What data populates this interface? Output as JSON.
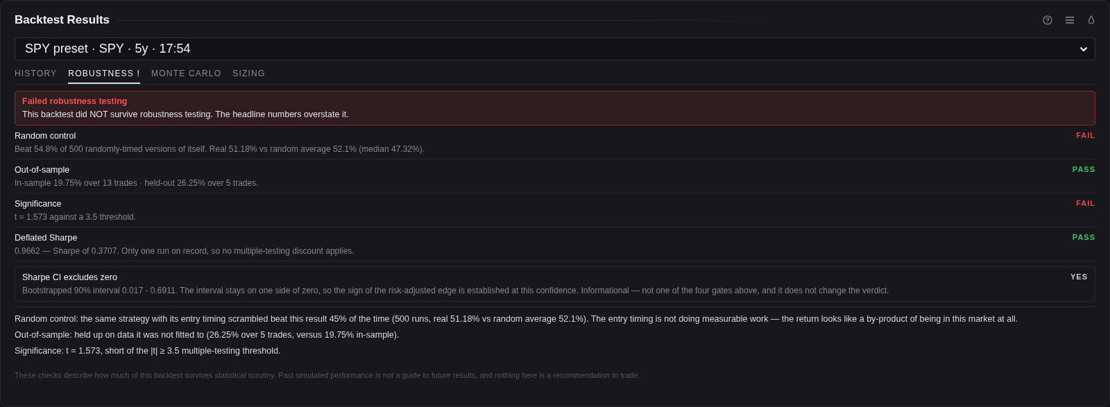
{
  "panel": {
    "title": "Backtest Results"
  },
  "selector": {
    "value": "SPY preset · SPY · 5y · 17:54"
  },
  "tabs": [
    {
      "label": "HISTORY",
      "selected": false
    },
    {
      "label": "ROBUSTNESS !",
      "selected": true
    },
    {
      "label": "MONTE CARLO",
      "selected": false
    },
    {
      "label": "SIZING",
      "selected": false
    }
  ],
  "alert": {
    "title": "Failed robustness testing",
    "message": "This backtest did NOT survive robustness testing. The headline numbers overstate it."
  },
  "checks": [
    {
      "kind": "fail",
      "name": "Random control",
      "verdict": "FAIL",
      "detail": "Beat 54.8% of 500 randomly-timed versions of itself. Real 51.18% vs random average 52.1% (median 47.32%)."
    },
    {
      "kind": "pass",
      "name": "Out-of-sample",
      "verdict": "PASS",
      "detail": "In-sample 19.75% over 13 trades · held-out 26.25% over 5 trades."
    },
    {
      "kind": "fail",
      "name": "Significance",
      "verdict": "FAIL",
      "detail": "t = 1.573 against a 3.5 threshold."
    },
    {
      "kind": "pass",
      "name": "Deflated Sharpe",
      "verdict": "PASS",
      "detail": "0.9662 — Sharpe of 0.3707. Only one run on record, so no multiple-testing discount applies."
    },
    {
      "kind": "info",
      "name": "Sharpe CI excludes zero",
      "verdict": "YES",
      "detail": "Bootstrapped 90% interval 0.017 - 0.6911. The interval stays on one side of zero, so the sign of the risk-adjusted edge is established at this confidence. Informational — not one of the four gates above, and it does not change the verdict."
    }
  ],
  "explanations": [
    "Random control: the same strategy with its entry timing scrambled beat this result 45% of the time (500 runs, real 51.18% vs random average 52.1%). The entry timing is not doing measurable work — the return looks like a by-product of being in this market at all.",
    "Out-of-sample: held up on data it was not fitted to (26.25% over 5 trades, versus 19.75% in-sample).",
    "Significance: t = 1.573, short of the |t| ≥ 3.5 multiple-testing threshold."
  ],
  "disclaimer": "These checks describe how much of this backtest survives statistical scrutiny. Past simulated performance is not a guide to future results, and nothing here is a recommendation to trade."
}
